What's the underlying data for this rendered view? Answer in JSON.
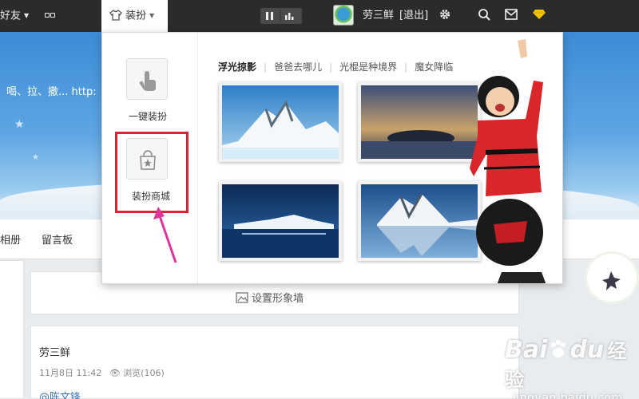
{
  "topbar": {
    "friends": "好友",
    "apps": "应用",
    "dress": "装扮",
    "username": "劳三鲜",
    "logout": "[退出]"
  },
  "banner": {
    "text": "喝、拉、撒... http:"
  },
  "nav": {
    "album": "相册",
    "guestbook": "留言板"
  },
  "dropdown": {
    "one_click": "一键装扮",
    "shop": "装扮商城",
    "tabs": [
      "浮光掠影",
      "爸爸去哪儿",
      "光棍是种境界",
      "魔女降临"
    ]
  },
  "content": {
    "set_image_wall": "设置形象墙",
    "post_author": "劳三鲜",
    "post_time": "11月8日 11:42",
    "post_views": "浏览(106)",
    "mention": "@陈文锋"
  },
  "watermark": {
    "brand": "Bai",
    "brand2": "du",
    "cn": "经验",
    "url": "jingyan.baidu.com"
  },
  "colors": {
    "topbar": "#2b2b2b",
    "highlight": "#d8262b",
    "arrow": "#e0339a",
    "accent": "#f5c400"
  }
}
